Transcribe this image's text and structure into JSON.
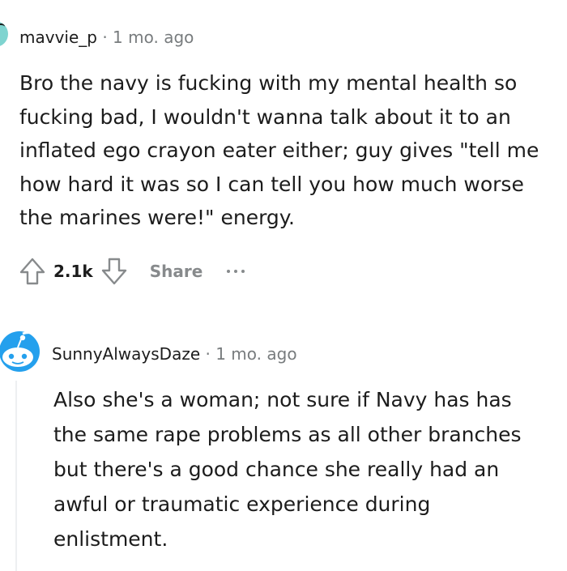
{
  "comment1": {
    "author": "mavvie_p",
    "separator": "·",
    "time": "1 mo. ago",
    "body": "Bro the navy is fucking with my mental health so fucking bad, I wouldn't wanna talk about it to an inflated ego crayon eater either; guy gives \"tell me how hard it was so I can tell you how much worse the marines were!\" energy.",
    "score": "2.1k",
    "share_label": "Share"
  },
  "comment2": {
    "author": "SunnyAlwaysDaze",
    "separator": "·",
    "time": "1 mo. ago",
    "body": "Also she's a woman; not sure if Navy has has the same rape problems as all other branches but there's a good chance she really had an awful or traumatic experience during enlistment."
  },
  "colors": {
    "text": "#1c1c1c",
    "meta_gray": "#787c7e",
    "action_gray": "#878a8c",
    "thread_line": "#edeff1",
    "avatar_blue": "#24a0ed",
    "avatar_teal": "#7fd4d0"
  },
  "icons": {
    "upvote": "upvote-arrow-icon",
    "downvote": "downvote-arrow-icon",
    "more": "more-options-icon"
  }
}
